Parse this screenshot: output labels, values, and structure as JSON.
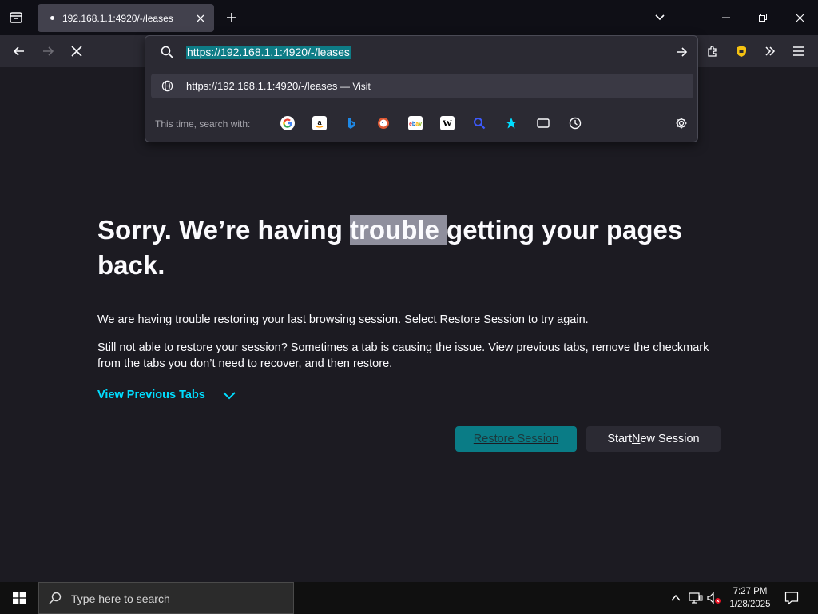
{
  "tab": {
    "title": "192.168.1.1:4920/-/leases"
  },
  "url_panel": {
    "input_value": "https://192.168.1.1:4920/-/leases",
    "suggestion_url": "https://192.168.1.1:4920/-/leases",
    "suggestion_action": "— Visit",
    "search_with_label": "This time, search with:",
    "engines": [
      "google-icon",
      "amazon-icon",
      "bing-icon",
      "duckduckgo-icon",
      "ebay-icon",
      "wikipedia-icon",
      "search-icon",
      "bookmarks-star-icon",
      "tabs-icon",
      "history-clock-icon"
    ]
  },
  "page": {
    "heading_before": "Sorry. We’re having ",
    "heading_highlight": "trouble ",
    "heading_after": "getting your pages back.",
    "para1": "We are having trouble restoring your last browsing session. Select Restore Session to try again.",
    "para2": "Still not able to restore your session? Sometimes a tab is causing the issue. View previous tabs, remove the checkmark from the tabs you don’t need to recover, and then restore.",
    "view_previous_tabs": "View Previous Tabs",
    "restore_button": "Restore Session",
    "new_session_button_pre": "Start ",
    "new_session_button_u": "N",
    "new_session_button_post": "ew Session"
  },
  "taskbar": {
    "search_placeholder": "Type here to search",
    "time": "7:27 PM",
    "date": "1/28/2025"
  },
  "colors": {
    "accent": "#00ddff",
    "restore_button": "#0a7c86",
    "page_bg": "#1c1b22"
  }
}
